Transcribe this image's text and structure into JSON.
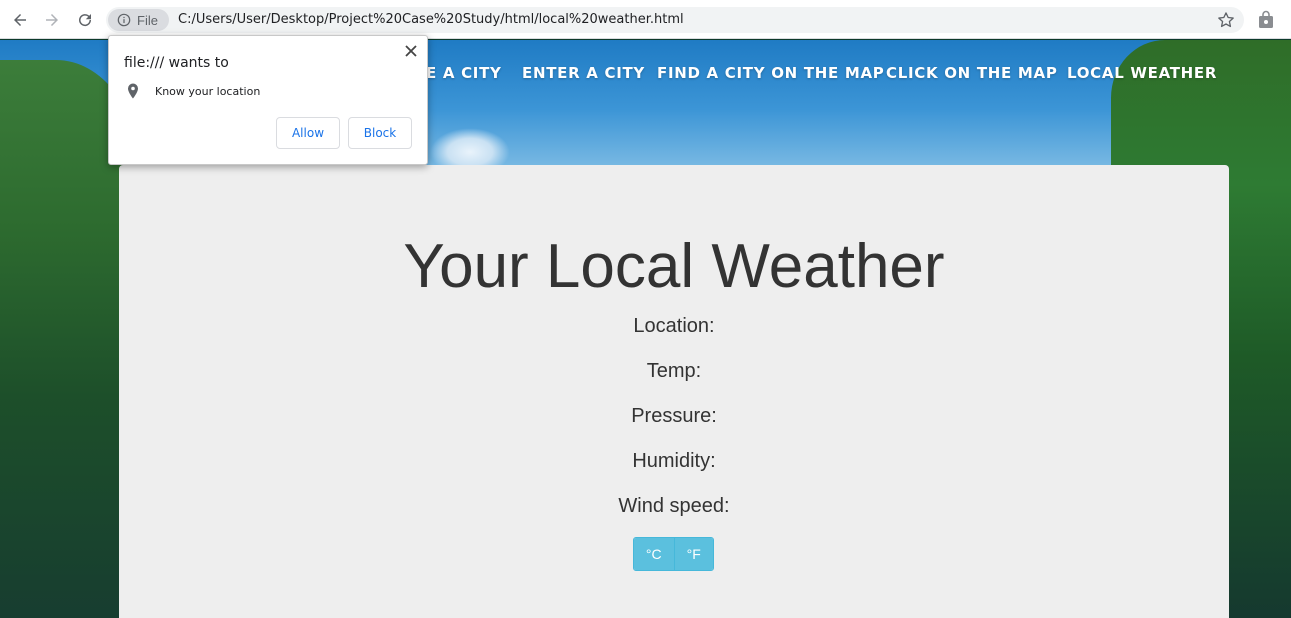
{
  "browser": {
    "chip_label": "File",
    "url": "C:/Users/User/Desktop/Project%20Case%20Study/html/local%20weather.html"
  },
  "nav": {
    "items": [
      {
        "label": "E A CITY"
      },
      {
        "label": "ENTER A CITY"
      },
      {
        "label": "FIND A CITY ON THE MAP"
      },
      {
        "label": "CLICK ON THE MAP"
      },
      {
        "label": "LOCAL WEATHER"
      }
    ]
  },
  "weather": {
    "title": "Your Local Weather",
    "location_label": "Location:",
    "temp_label": "Temp:",
    "pressure_label": "Pressure:",
    "humidity_label": "Humidity:",
    "wind_label": "Wind speed:",
    "celsius_label": "°C",
    "fahrenheit_label": "°F"
  },
  "popup": {
    "title": "file:/// wants to",
    "permission": "Know your location",
    "allow_label": "Allow",
    "block_label": "Block"
  },
  "colors": {
    "accent": "#5bc0de",
    "panel": "#eeeeee",
    "link_blue": "#1a73e8"
  }
}
